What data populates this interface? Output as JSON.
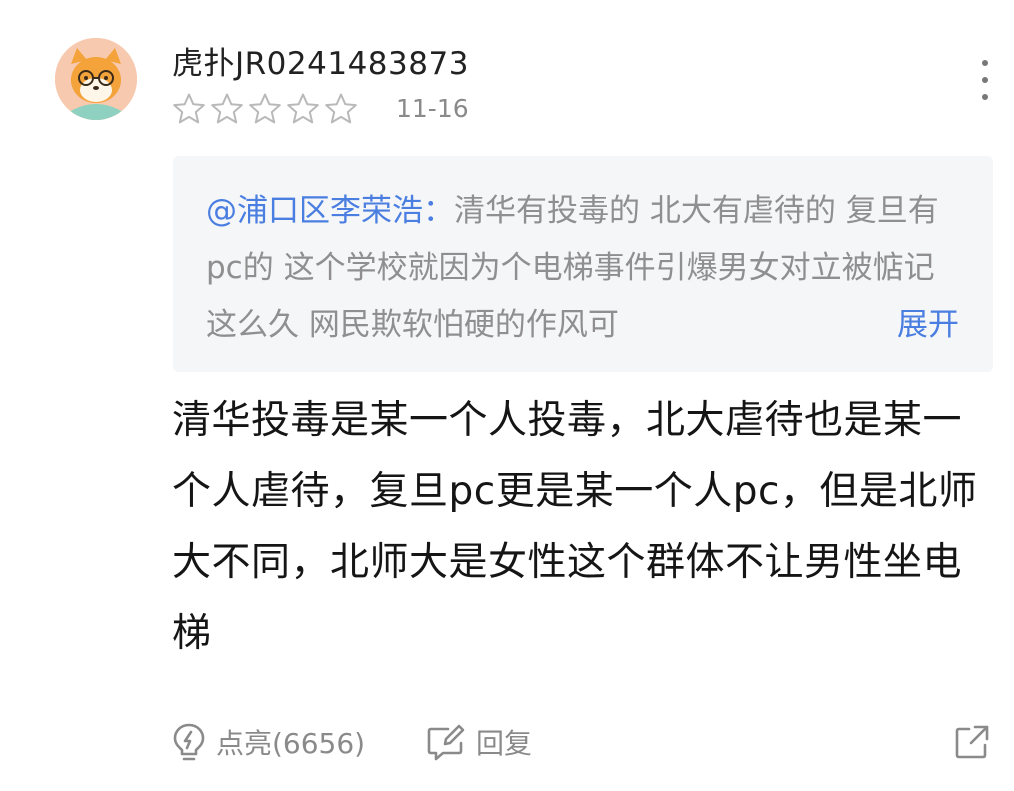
{
  "comment": {
    "username": "虎扑JR0241483873",
    "rating_stars": 0,
    "rating_max": 5,
    "date": "11-16",
    "quote": {
      "author": "@浦口区李荣浩：",
      "text": "清华有投毒的 北大有虐待的 复旦有pc的 这个学校就因为个电梯事件引爆男女对立被惦记这么久 网民欺软怕硬的作风可",
      "expand_label": "展开"
    },
    "body": "清华投毒是某一个人投毒，北大虐待也是某一个人虐待，复旦pc更是某一个人pc，但是北师大不同，北师大是女性这个群体不让男性坐电梯"
  },
  "actions": {
    "like_label": "点亮(6656)",
    "reply_label": "回复"
  },
  "icons": {
    "avatar": "cartoon-fox-avatar",
    "more": "vertical-dots-icon",
    "star": "star-outline-icon",
    "like": "lightbulb-icon",
    "reply": "edit-reply-icon",
    "share": "share-external-icon"
  },
  "colors": {
    "link": "#4a7ee0",
    "muted": "#8a8a8a",
    "quote_bg": "#f5f6f8"
  }
}
